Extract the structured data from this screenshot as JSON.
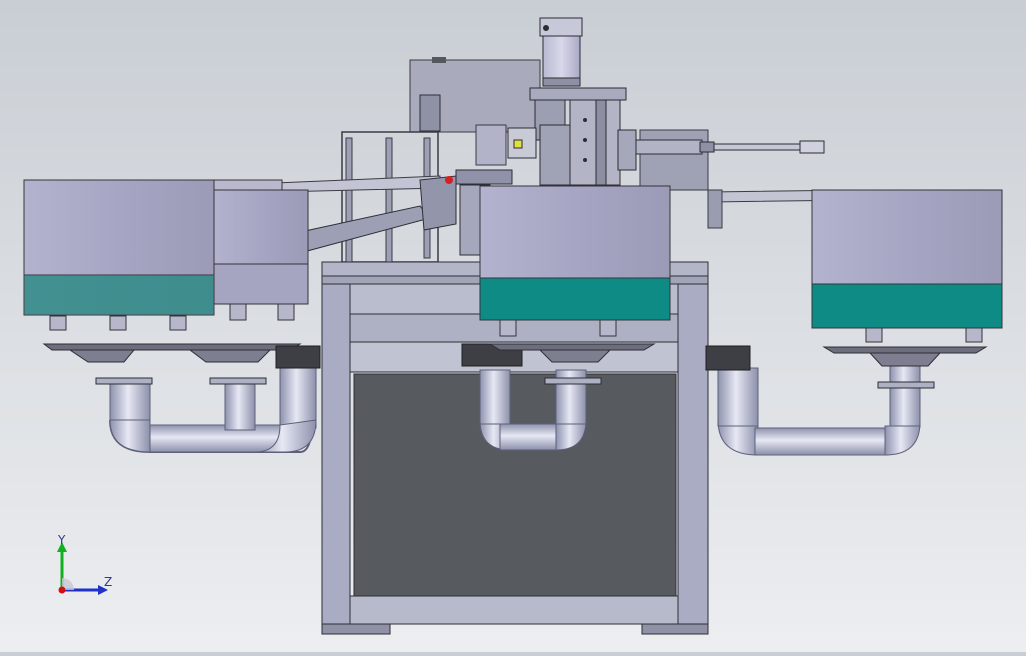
{
  "viewport": {
    "background_top": "#c9ced4",
    "background_bottom": "#eceef0"
  },
  "machine": {
    "bowls": [
      {
        "id": "left-front",
        "body": "#a9a9c7",
        "band": "#2f8a86"
      },
      {
        "id": "left-rear",
        "body": "#a5a5c2",
        "band": "#a5a5c2"
      },
      {
        "id": "center",
        "body": "#a8a8c8",
        "band": "#0f8b85"
      },
      {
        "id": "right",
        "body": "#a9a9c7",
        "band": "#0f8b85"
      }
    ],
    "colors": {
      "frame": "#a9acc2",
      "frame_edge": "#33343a",
      "panel": "#575a5e",
      "pipe": "#b8bcd6",
      "accent_red": "#d42020"
    }
  },
  "triad": {
    "y_label": "Y",
    "z_label": "Z",
    "y_color": "#10b020",
    "z_color": "#2030c8",
    "origin_color": "#d01010"
  }
}
